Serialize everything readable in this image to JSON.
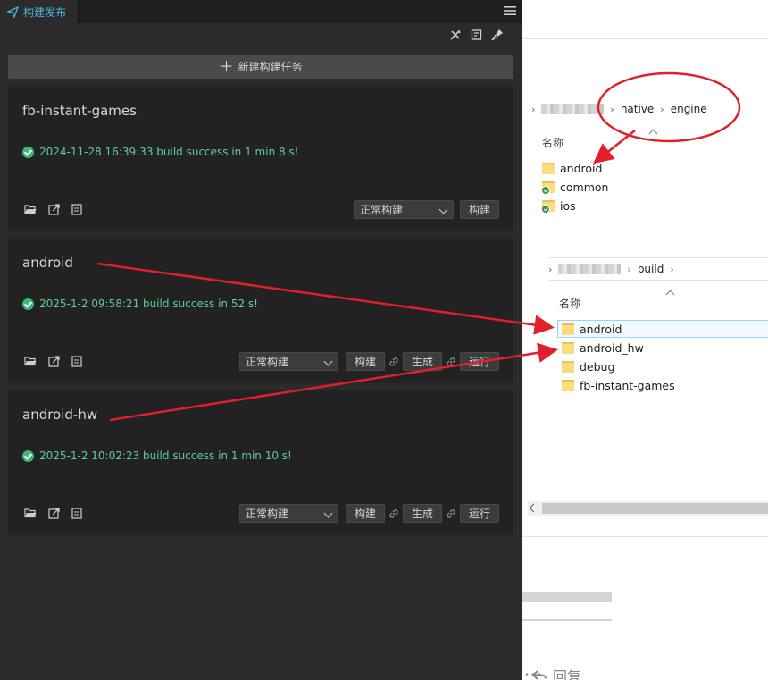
{
  "panel": {
    "tab_title": "构建发布",
    "new_task_label": "新建构建任务",
    "tasks": [
      {
        "name": "fb-instant-games",
        "status": "2024-11-28 16:39:33 build success in 1 min 8 s!",
        "build_mode": "正常构建",
        "build_label": "构建"
      },
      {
        "name": "android",
        "status": "2025-1-2 09:58:21 build success in 52 s!",
        "build_mode": "正常构建",
        "build_label": "构建",
        "generate_label": "生成",
        "run_label": "运行"
      },
      {
        "name": "android-hw",
        "status": "2025-1-2 10:02:23 build success in 1 min 10 s!",
        "build_mode": "正常构建",
        "build_label": "构建",
        "generate_label": "生成",
        "run_label": "运行"
      }
    ]
  },
  "explorer": {
    "top": {
      "breadcrumb": [
        "native",
        "engine"
      ],
      "column_name": "名称",
      "items": [
        {
          "name": "android",
          "synced": false
        },
        {
          "name": "common",
          "synced": true
        },
        {
          "name": "ios",
          "synced": true
        }
      ]
    },
    "bottom": {
      "breadcrumb": [
        "build"
      ],
      "column_name": "名称",
      "items": [
        {
          "name": "android",
          "selected": true
        },
        {
          "name": "android_hw",
          "selected": false
        },
        {
          "name": "debug",
          "selected": false
        },
        {
          "name": "fb-instant-games",
          "selected": false
        }
      ]
    },
    "reply_label": "回复"
  },
  "colors": {
    "accent": "#4cb3e6",
    "success": "#5fcf9a",
    "annotation": "#e0202a"
  }
}
